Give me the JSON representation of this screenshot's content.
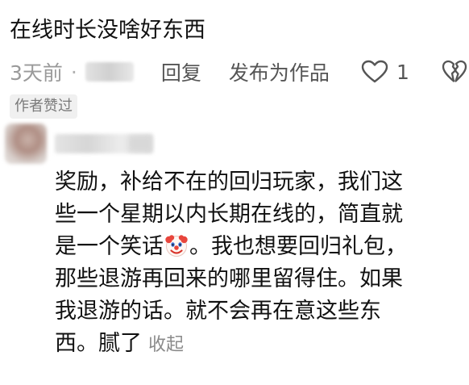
{
  "comment": {
    "text": "在线时长没啥好东西",
    "time": "3天前",
    "separator": "·",
    "reply_label": "回复",
    "publish_label": "发布为作品",
    "like_count": "1",
    "author_liked_label": "作者赞过"
  },
  "reply": {
    "lines": [
      "奖励，补给不在的回归玩家，我们这",
      "些一个星期以内长期在线的，简直就",
      "是一个笑话",
      "。我也想要回归礼包，",
      "那些退游再回来的哪里留得住。如果",
      "我退游的话。就不会再在意这些东",
      "西。腻了"
    ],
    "collapse_label": "收起",
    "emoji": "clown-face-icon"
  },
  "colors": {
    "text": "#111111",
    "meta": "#8a8a8a",
    "badge_bg": "#f0f0f0"
  }
}
